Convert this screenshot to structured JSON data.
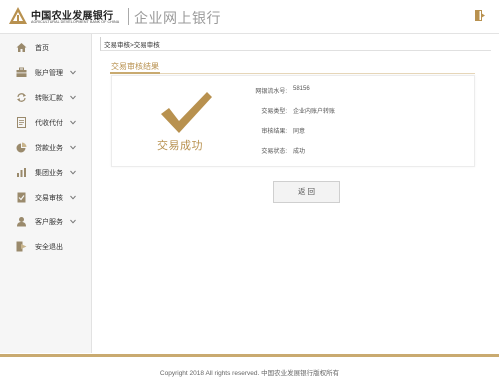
{
  "header": {
    "bank_name_cn": "中国农业发展银行",
    "bank_name_en": "AGRICULTURAL DEVELOPMENT BANK OF CHINA",
    "portal_title": "企业网上银行",
    "logo_icon": "adbc-logo",
    "exit_icon": "logout-icon"
  },
  "sidebar": {
    "items": [
      {
        "label": "首页",
        "icon": "home-icon",
        "has_submenu": false
      },
      {
        "label": "账户管理",
        "icon": "briefcase-icon",
        "has_submenu": true
      },
      {
        "label": "转账汇款",
        "icon": "transfer-icon",
        "has_submenu": true
      },
      {
        "label": "代收代付",
        "icon": "document-icon",
        "has_submenu": true
      },
      {
        "label": "贷款业务",
        "icon": "pie-chart-icon",
        "has_submenu": true
      },
      {
        "label": "集团业务",
        "icon": "bar-chart-icon",
        "has_submenu": true
      },
      {
        "label": "交易审核",
        "icon": "audit-icon",
        "has_submenu": true
      },
      {
        "label": "客户服务",
        "icon": "customer-service-icon",
        "has_submenu": true
      },
      {
        "label": "安全退出",
        "icon": "exit-icon",
        "has_submenu": false
      }
    ]
  },
  "breadcrumb": "交易审核>交易审核",
  "section_title": "交易审核结果",
  "result": {
    "status_icon": "checkmark-icon",
    "status_text": "交易成功",
    "fields": [
      {
        "label": "网银流水号:",
        "value": "58156"
      },
      {
        "label": "交易类型:",
        "value": "企业内账户转账"
      },
      {
        "label": "审核结果:",
        "value": "同意"
      },
      {
        "label": "交易状态:",
        "value": "成功"
      }
    ]
  },
  "actions": {
    "back_label": "返 回"
  },
  "footer": {
    "copyright": "Copyright 2018 All rights reserved. 中国农业发展银行版权所有"
  },
  "colors": {
    "brand_gold": "#b8914f",
    "footer_line": "#c9aa70",
    "sidebar_bg": "#f6f6f6"
  }
}
